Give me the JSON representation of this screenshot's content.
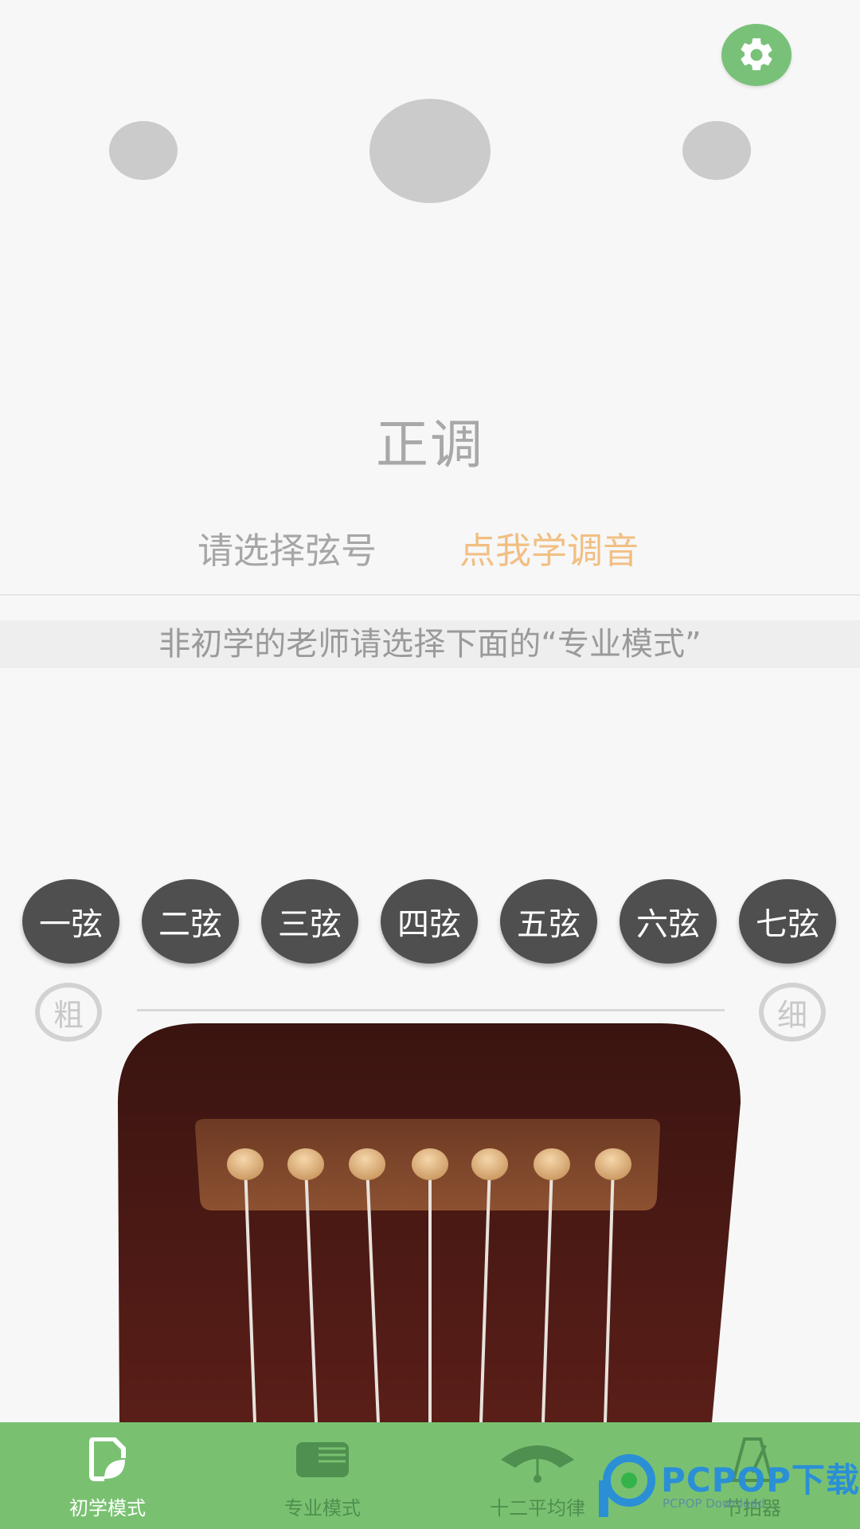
{
  "header": {
    "settings_icon": "gear-icon",
    "settings_color": "#79c179"
  },
  "tuning": {
    "title": "正调",
    "select_string": "请选择弦号",
    "learn_link": "点我学调音",
    "learn_color": "#f1bf83"
  },
  "hint": {
    "text": "非初学的老师请选择下面的“专业模式”"
  },
  "strings": [
    {
      "label": "一弦"
    },
    {
      "label": "二弦"
    },
    {
      "label": "三弦"
    },
    {
      "label": "四弦"
    },
    {
      "label": "五弦"
    },
    {
      "label": "六弦"
    },
    {
      "label": "七弦"
    }
  ],
  "thickness": {
    "thick": "粗",
    "thin": "细"
  },
  "nav": {
    "color": "#79c171",
    "items": [
      {
        "label": "初学模式",
        "icon": "beginner-mode-icon",
        "active": true
      },
      {
        "label": "专业模式",
        "icon": "pro-mode-icon",
        "active": false
      },
      {
        "label": "十二平均律",
        "icon": "equal-temperament-icon",
        "active": false
      },
      {
        "label": "节拍器",
        "icon": "metronome-icon",
        "active": false
      }
    ]
  },
  "watermark": {
    "text": "PCPOP下载",
    "sub": "PCPOP Download"
  }
}
